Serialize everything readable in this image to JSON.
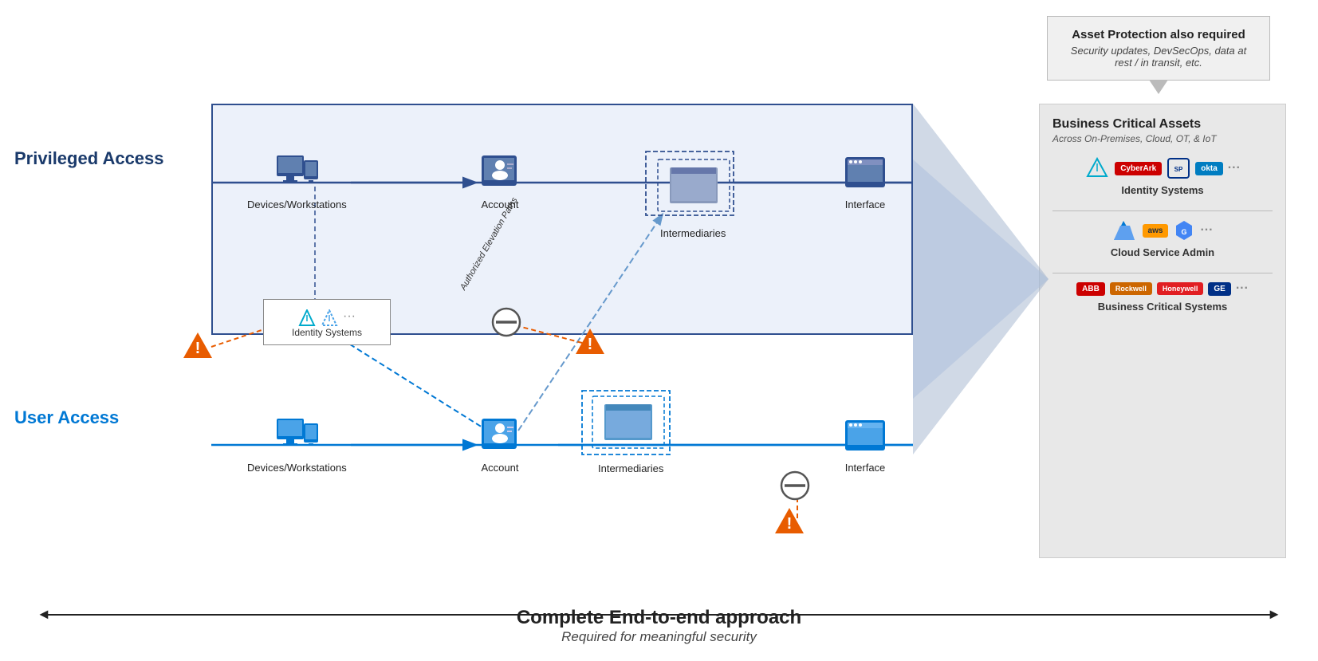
{
  "callout": {
    "title": "Asset Protection also required",
    "subtitle": "Security updates, DevSecOps, data at rest / in transit, etc."
  },
  "labels": {
    "privileged_access": "Privileged Access",
    "user_access": "User Access",
    "bca_title": "Business Critical Assets",
    "bca_subtitle": "Across On-Premises, Cloud, OT, & IoT",
    "identity_systems": "Identity Systems",
    "cloud_service_admin": "Cloud Service Admin",
    "business_critical_systems": "Business Critical Systems",
    "bottom_main": "Complete End-to-end approach",
    "bottom_sub": "Required for meaningful security"
  },
  "priv_flow": {
    "devices": "Devices/Workstations",
    "account": "Account",
    "intermediaries": "Intermediaries",
    "interface": "Interface"
  },
  "user_flow": {
    "devices": "Devices/Workstations",
    "account": "Account",
    "intermediaries": "Intermediaries",
    "interface": "Interface"
  },
  "elevation": {
    "label": "Authorized Elevation Paths"
  },
  "identity_popup": {
    "label": "Identity Systems"
  },
  "logos": {
    "identity": [
      "Ping",
      "CyberArk",
      "SailPoint",
      "okta",
      "..."
    ],
    "cloud": [
      "azure",
      "aws",
      "GCP",
      "..."
    ],
    "ot": [
      "ABB",
      "Rockwell",
      "Honeywell",
      "GE",
      "..."
    ]
  },
  "colors": {
    "priv_blue": "#2f4f8f",
    "user_blue": "#0078d4",
    "warning_orange": "#e85c00",
    "no_entry": "#555"
  }
}
